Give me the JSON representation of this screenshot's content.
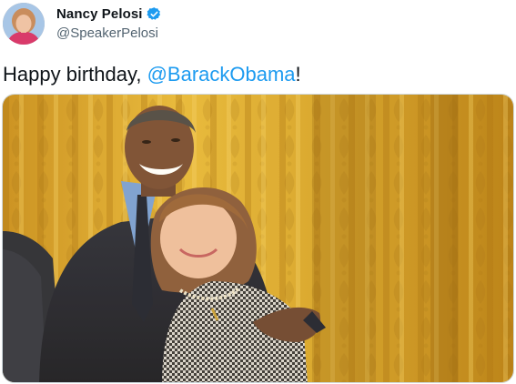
{
  "author": {
    "display_name": "Nancy Pelosi",
    "handle": "@SpeakerPelosi",
    "verified": true,
    "avatar_icon": "profile-photo"
  },
  "tweet": {
    "text_before": "Happy birthday, ",
    "mention": "@BarackObama",
    "text_after": "!"
  },
  "media": {
    "icon": "photo"
  },
  "colors": {
    "link": "#1d9bf0",
    "verified_badge": "#1d9bf0",
    "handle": "#536471",
    "text": "#0f1419",
    "curtain": "#d9a72c"
  }
}
